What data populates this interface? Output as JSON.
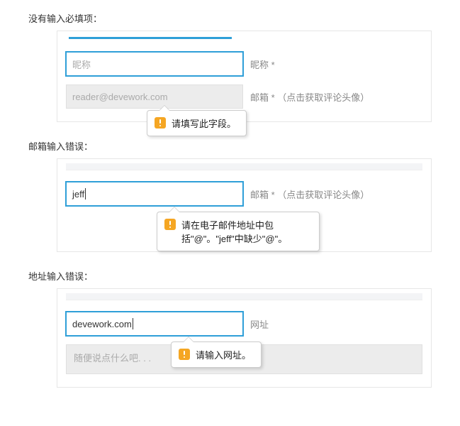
{
  "sections": {
    "s1": {
      "title": "没有输入必填项：",
      "nick_label": "昵称 *",
      "nick_placeholder": "昵称",
      "email_label": "邮箱 * （点击获取评论头像）",
      "email_placeholder": "reader@devework.com",
      "tooltip": "请填写此字段。"
    },
    "s2": {
      "title": "邮箱输入错误：",
      "email_label": "邮箱 * （点击获取评论头像）",
      "email_value": "jeff",
      "tooltip": "请在电子邮件地址中包括\"@\"。\"jeff\"中缺少\"@\"。"
    },
    "s3": {
      "title": "地址输入错误：",
      "url_label": "网址",
      "url_value": "devework.com",
      "tooltip": "请输入网址。",
      "textarea_placeholder": "随便说点什么吧. . ."
    }
  }
}
